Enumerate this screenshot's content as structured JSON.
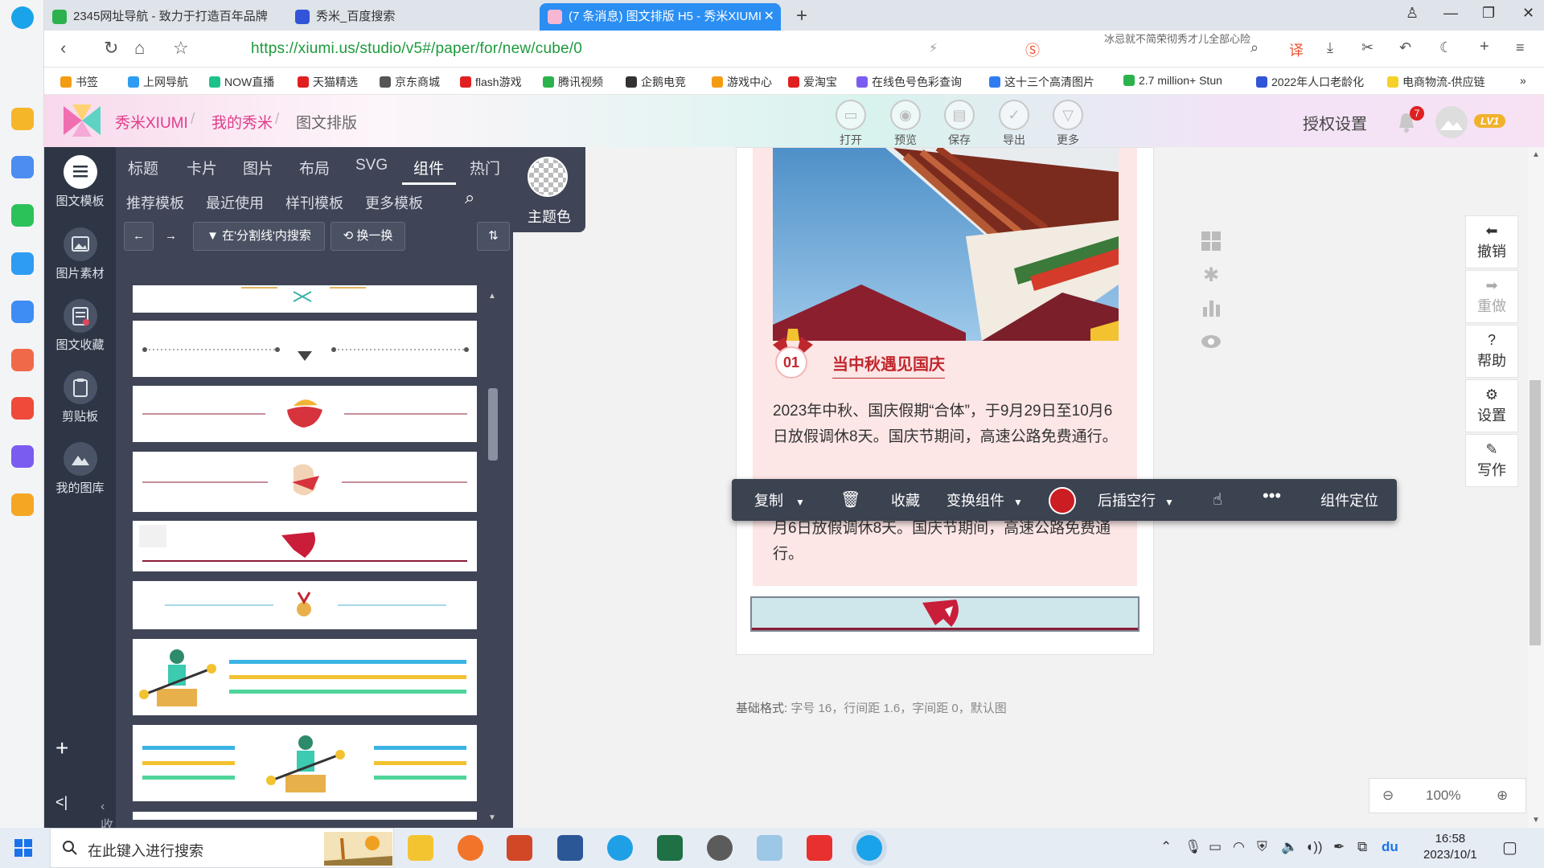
{
  "browser": {
    "tabs": [
      {
        "title": "2345网址导航 - 致力于打造百年品牌"
      },
      {
        "title": "秀米_百度搜索"
      },
      {
        "title": "(7 条消息) 图文排版 H5 - 秀米XIUMI"
      }
    ],
    "url": "https://xiumi.us/studio/v5#/paper/for/new/cube/0",
    "marquee": "冰忌就不简荣彻秀才儿全部心险",
    "bookmarks": [
      "书签",
      "上网导航",
      "NOW直播",
      "天猫精选",
      "京东商城",
      "flash游戏",
      "腾讯视频",
      "企鹅电竞",
      "游戏中心",
      "爱淘宝",
      "在线色号色彩查询",
      "这十三个高清图片",
      "2.7 million+ Stun",
      "2022年人口老龄化",
      "电商物流-供应链"
    ]
  },
  "header": {
    "brand": "秀米XIUMI",
    "crumbs": [
      "我的秀米",
      "图文排版"
    ],
    "actions": [
      "打开",
      "预览",
      "保存",
      "导出",
      "更多"
    ],
    "auth": "授权设置",
    "notifications": "7",
    "level": "LV1"
  },
  "sidebar": {
    "items": [
      "图文模板",
      "图片素材",
      "图文收藏",
      "剪贴板",
      "我的图库"
    ],
    "collapse": "收起"
  },
  "panel": {
    "tabs": [
      "标题",
      "卡片",
      "图片",
      "布局",
      "SVG",
      "组件",
      "热门"
    ],
    "subtabs": [
      "推荐模板",
      "最近使用",
      "样刊模板",
      "更多模板"
    ],
    "filter": "在'分割线'内搜索",
    "shuffle": "换一换",
    "theme": "主题色"
  },
  "article": {
    "number": "01",
    "heading": "当中秋遇见国庆",
    "para1": "2023年中秋、国庆假期“合体”，于9月29日至10月6日放假调休8天。国庆节期间，高速公路免费通行。",
    "para2": "月6日放假调休8天。国庆节期间，高速公路免费通行。",
    "footer_label": "基础格式:",
    "footer_value": "字号 16，行间距 1.6，字间距 0，默认图"
  },
  "floatbar": {
    "copy": "复制",
    "favorite": "收藏",
    "switch": "变换组件",
    "insert": "后插空行",
    "locate": "组件定位",
    "color": "#cc1d22"
  },
  "righttools": [
    "撤销",
    "重做",
    "帮助",
    "设置",
    "写作"
  ],
  "zoom": "100%",
  "taskbar": {
    "search": "在此键入进行搜索",
    "time": "16:58",
    "date": "2023/10/1"
  }
}
